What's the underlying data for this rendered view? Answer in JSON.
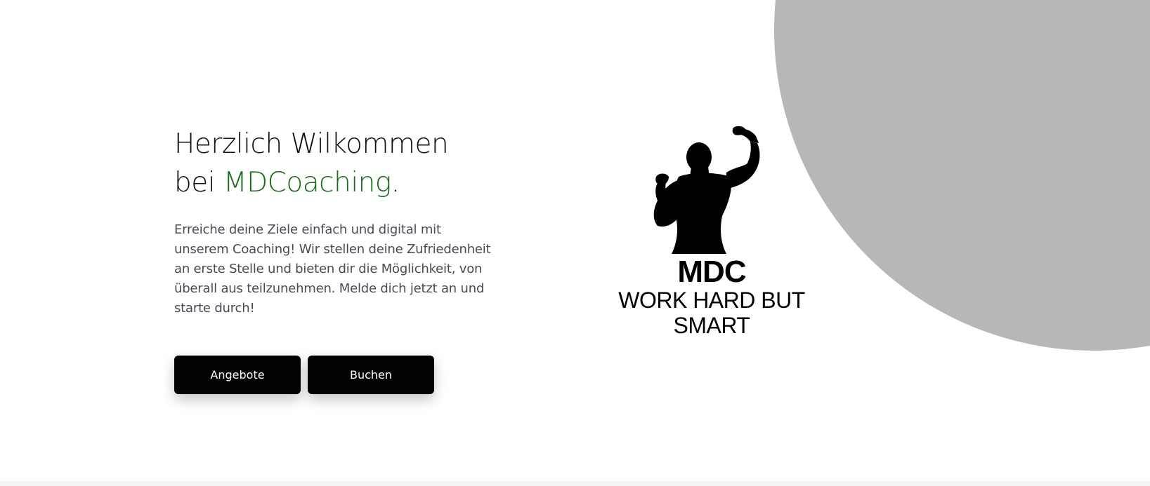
{
  "hero": {
    "headline_line1": "Herzlich Wilkommen",
    "headline_prefix": "bei ",
    "headline_brand": "MDCoaching",
    "headline_suffix": ".",
    "intro": "Erreiche deine Ziele einfach und digital mit unserem Coaching! Wir stellen deine Zufriedenheit an erste Stelle und bieten dir die Möglichkeit, von überall aus teilzunehmen. Melde dich jetzt an und starte durch!"
  },
  "buttons": {
    "offers_label": "Angebote",
    "book_label": "Buchen"
  },
  "logo": {
    "mark": "MDC",
    "tagline": "WORK HARD BUT SMART",
    "icon": "flexing-bodybuilder-silhouette"
  },
  "colors": {
    "brand_green": "#1b6b1b",
    "button_bg": "#030303",
    "circle_gray": "#b7b7b7"
  }
}
